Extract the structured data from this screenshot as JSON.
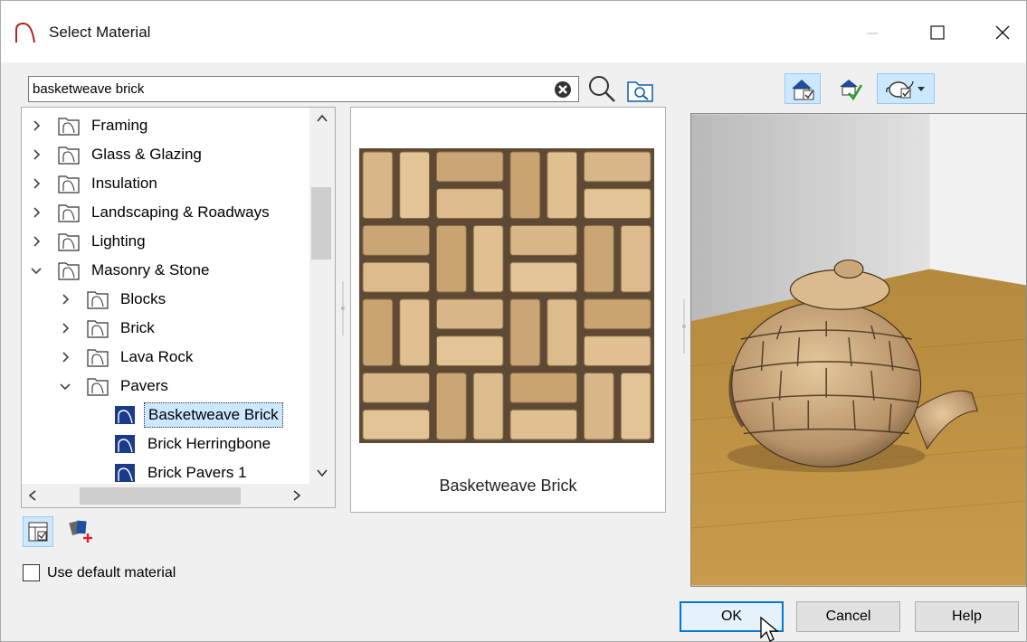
{
  "window": {
    "title": "Select Material"
  },
  "search": {
    "value": "basketweave brick"
  },
  "tree": {
    "items": [
      {
        "label": "Framing",
        "expanded": false,
        "depth": 0,
        "type": "folder"
      },
      {
        "label": "Glass & Glazing",
        "expanded": false,
        "depth": 0,
        "type": "folder"
      },
      {
        "label": "Insulation",
        "expanded": false,
        "depth": 0,
        "type": "folder"
      },
      {
        "label": "Landscaping & Roadways",
        "expanded": false,
        "depth": 0,
        "type": "folder"
      },
      {
        "label": "Lighting",
        "expanded": false,
        "depth": 0,
        "type": "folder"
      },
      {
        "label": "Masonry & Stone",
        "expanded": true,
        "depth": 0,
        "type": "folder"
      },
      {
        "label": "Blocks",
        "expanded": false,
        "depth": 1,
        "type": "folder"
      },
      {
        "label": "Brick",
        "expanded": false,
        "depth": 1,
        "type": "folder"
      },
      {
        "label": "Lava Rock",
        "expanded": false,
        "depth": 1,
        "type": "folder"
      },
      {
        "label": "Pavers",
        "expanded": true,
        "depth": 1,
        "type": "folder"
      },
      {
        "label": "Basketweave Brick",
        "depth": 2,
        "type": "material",
        "selected": true
      },
      {
        "label": "Brick Herringbone",
        "depth": 2,
        "type": "material"
      },
      {
        "label": "Brick Pavers 1",
        "depth": 2,
        "type": "material"
      }
    ]
  },
  "preview": {
    "label": "Basketweave Brick"
  },
  "options": {
    "use_default_label": "Use default material",
    "use_default_checked": false
  },
  "buttons": {
    "ok": "OK",
    "cancel": "Cancel",
    "help": "Help"
  },
  "icons": {
    "app": "chief-architect-arch-icon",
    "clear": "clear-search-icon",
    "search": "magnifier-icon",
    "folder_search": "folder-search-icon",
    "room_view": "room-render-icon",
    "plan_check": "plan-material-check-icon",
    "teapot": "teapot-preview-icon",
    "tree_view": "tree-view-toggle-icon",
    "add_material": "add-material-icon"
  },
  "colors": {
    "accent": "#0078d7",
    "selection": "#cce8ff",
    "folder_outline": "#333333",
    "material_icon": "#1a3a8a"
  }
}
